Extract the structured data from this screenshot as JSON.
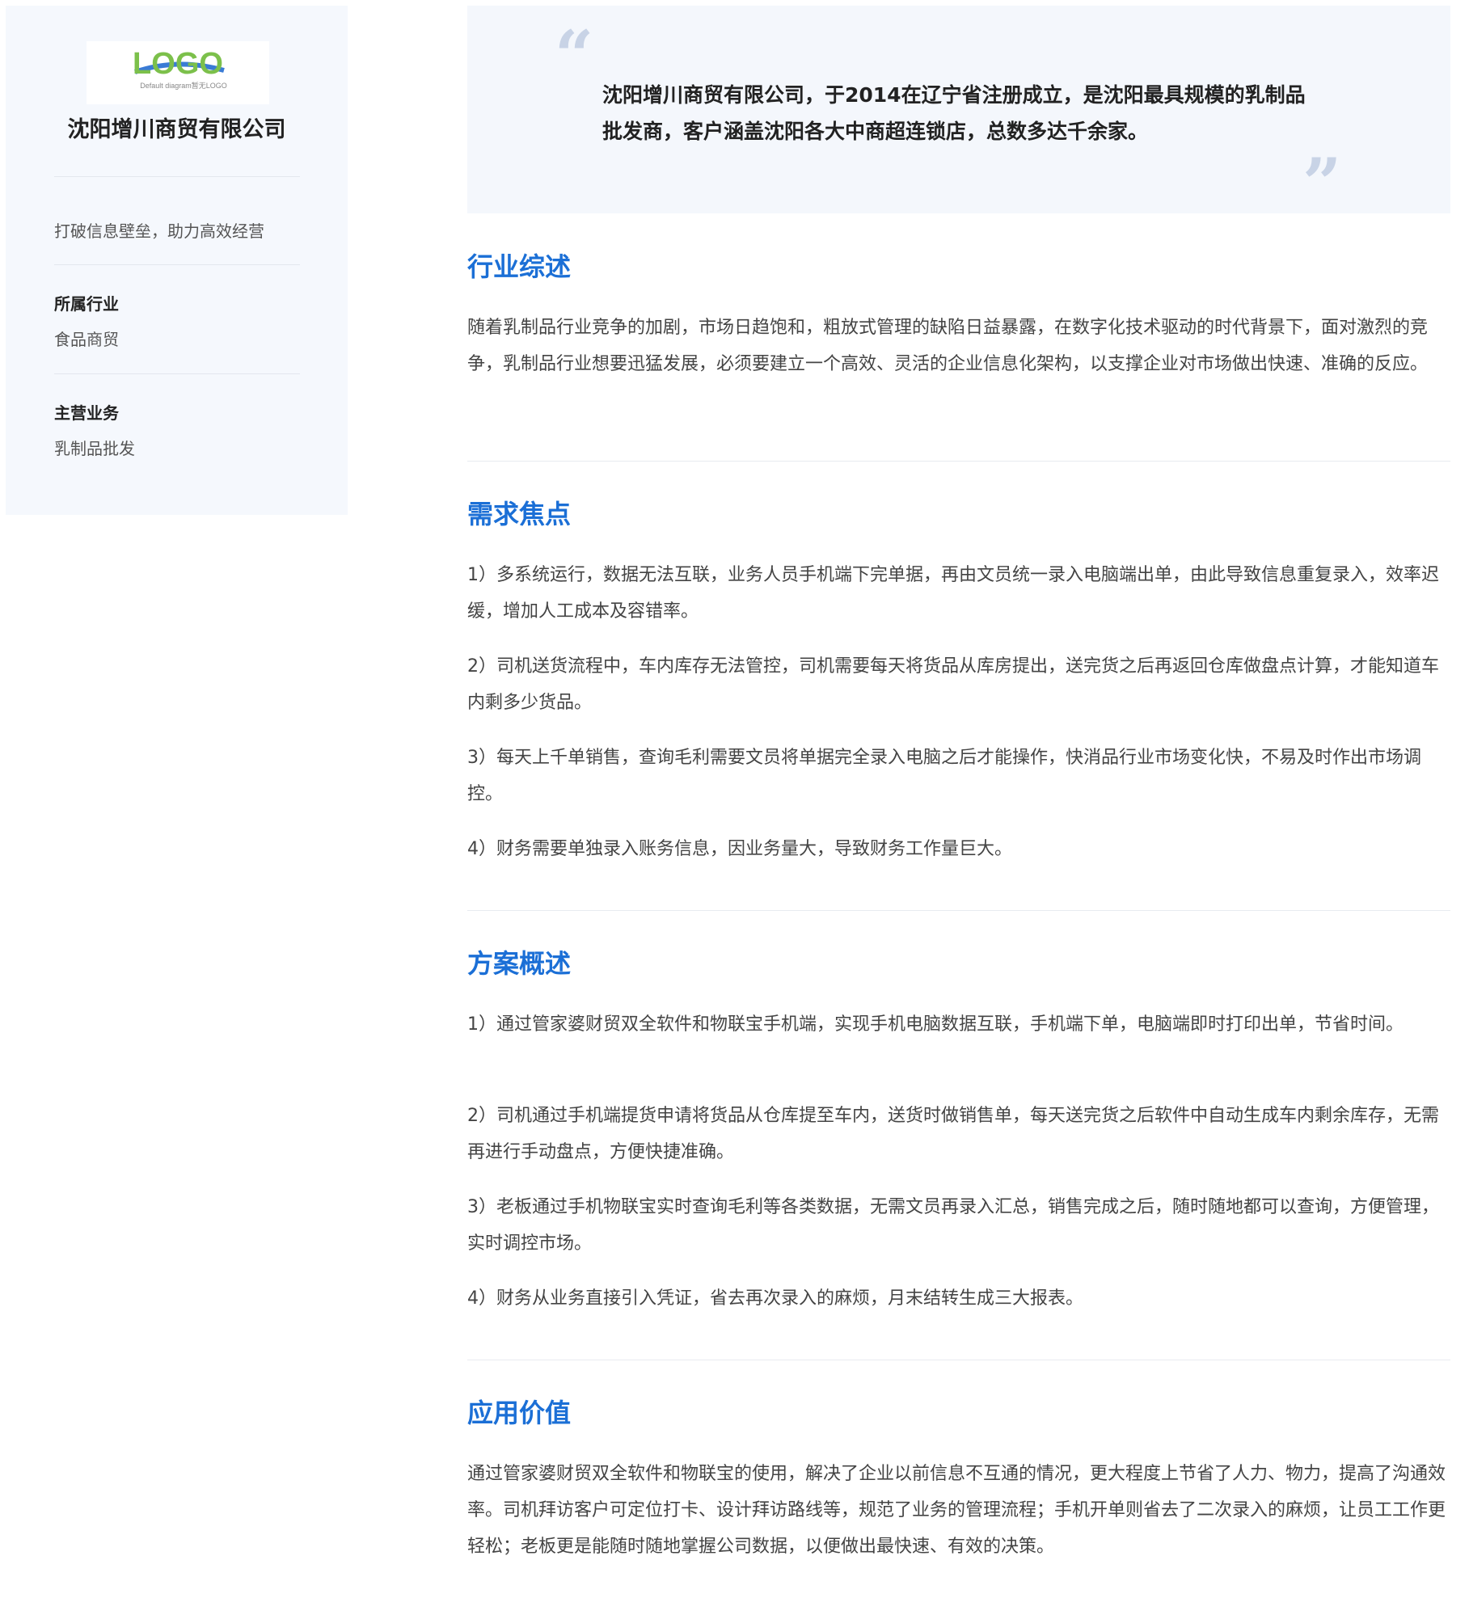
{
  "sidebar": {
    "logo_text": "LOGO",
    "logo_caption": "Default diagram暂无LOGO",
    "company_name": "沈阳增川商贸有限公司",
    "slogan": "打破信息壁垒，助力高效经营",
    "industry_label": "所属行业",
    "industry_value": "食品商贸",
    "business_label": "主营业务",
    "business_value": "乳制品批发"
  },
  "quote": {
    "text": "沈阳增川商贸有限公司，于2014在辽宁省注册成立，是沈阳最具规模的乳制品批发商，客户涵盖沈阳各大中商超连锁店，总数多达千余家。"
  },
  "sections": [
    {
      "title": "行业综述",
      "paragraphs": [
        "随着乳制品行业竞争的加剧，市场日趋饱和，粗放式管理的缺陷日益暴露，在数字化技术驱动的时代背景下，面对激烈的竞争，乳制品行业想要迅猛发展，必须要建立一个高效、灵活的企业信息化架构，以支撑企业对市场做出快速、准确的反应。"
      ]
    },
    {
      "title": "需求焦点",
      "paragraphs": [
        "1）多系统运行，数据无法互联，业务人员手机端下完单据，再由文员统一录入电脑端出单，由此导致信息重复录入，效率迟缓，增加人工成本及容错率。",
        "2）司机送货流程中，车内库存无法管控，司机需要每天将货品从库房提出，送完货之后再返回仓库做盘点计算，才能知道车内剩多少货品。",
        "3）每天上千单销售，查询毛利需要文员将单据完全录入电脑之后才能操作，快消品行业市场变化快，不易及时作出市场调控。",
        "4）财务需要单独录入账务信息，因业务量大，导致财务工作量巨大。"
      ]
    },
    {
      "title": "方案概述",
      "paragraphs": [
        "1）通过管家婆财贸双全软件和物联宝手机端，实现手机电脑数据互联，手机端下单，电脑端即时打印出单，节省时间。",
        "2）司机通过手机端提货申请将货品从仓库提至车内，送货时做销售单，每天送完货之后软件中自动生成车内剩余库存，无需再进行手动盘点，方便快捷准确。",
        "3）老板通过手机物联宝实时查询毛利等各类数据，无需文员再录入汇总，销售完成之后，随时随地都可以查询，方便管理，实时调控市场。",
        "4）财务从业务直接引入凭证，省去再次录入的麻烦，月末结转生成三大报表。"
      ]
    },
    {
      "title": "应用价值",
      "paragraphs": [
        "通过管家婆财贸双全软件和物联宝的使用，解决了企业以前信息不互通的情况，更大程度上节省了人力、物力，提高了沟通效率。司机拜访客户可定位打卡、设计拜访路线等，规范了业务的管理流程；手机开单则省去了二次录入的麻烦，让员工工作更轻松；老板更是能随时随地掌握公司数据，以便做出最快速、有效的决策。"
      ]
    }
  ]
}
